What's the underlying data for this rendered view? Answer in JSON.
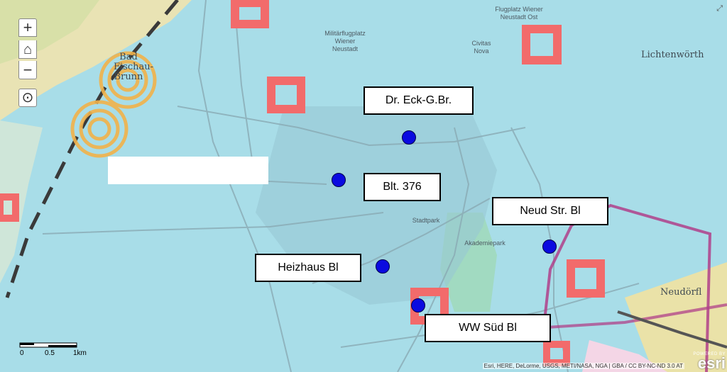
{
  "controls": {
    "zoom_in": "+",
    "zoom_out": "−",
    "home": "⌂",
    "locate": "⊙"
  },
  "labels": {
    "dr_eck": "Dr. Eck-G.Br.",
    "blt376": "Blt. 376",
    "neud_str": "Neud Str. Bl",
    "heizhaus": "Heizhaus Bl",
    "ww_sued": "WW Süd Bl"
  },
  "places": {
    "bad_fischau": "Bad\nFischau-\nBrunn",
    "militaer": "Militärflugplatz\nWiener\nNeustadt",
    "flugplatz_ost": "Flugplatz Wiener\nNeustadt Ost",
    "civitas": "Civitas\nNova",
    "lichtenwoerth": "Lichtenwörth",
    "neudoerfl": "Neudörfl",
    "akademiepark": "Akademiepark",
    "stadtpark": "Stadtpark"
  },
  "scale": {
    "zero": "0",
    "half": "0.5",
    "one": "1km"
  },
  "attribution": "Esri, HERE, DeLorme, USGS, METI/NASA, NGA | GBA / CC BY-NC-ND 3.0 AT",
  "esri": {
    "powered_by": "POWERED BY",
    "wordmark": "esri"
  },
  "colors": {
    "base": "#a8dde8",
    "protection_zone": "#f26b6b",
    "marker": "#0a0ae0",
    "boundary": "#b0408a",
    "well_ring": "#f2b24a"
  }
}
